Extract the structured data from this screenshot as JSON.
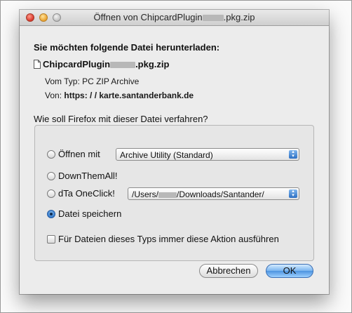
{
  "window": {
    "title_prefix": "Öffnen von  ChipcardPlugin",
    "title_suffix": ".pkg.zip"
  },
  "dialog": {
    "heading": "Sie möchten folgende Datei herunterladen:",
    "file_prefix": "ChipcardPlugin",
    "file_suffix": ".pkg.zip",
    "type_label": "Vom Typ:",
    "type_value": "PC ZIP Archive",
    "from_label": "Von:",
    "from_value": "https: / / karte.santanderbank.de",
    "question": "Wie soll Firefox mit dieser Datei verfahren?"
  },
  "options": {
    "open_with_label": "Öffnen mit",
    "open_with_app": "Archive Utility (Standard)",
    "downthemall_label": "DownThemAll!",
    "dta_label": "dTa OneClick!",
    "dta_path_prefix": "/Users/",
    "dta_path_suffix": "/Downloads/Santander/",
    "save_label": "Datei speichern",
    "selected": "save",
    "always_label": "Für Dateien dieses Typs immer diese Aktion ausführen",
    "always_checked": false
  },
  "buttons": {
    "cancel": "Abbrechen",
    "ok": "OK"
  }
}
